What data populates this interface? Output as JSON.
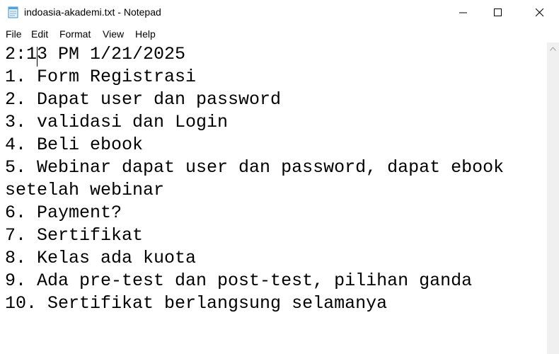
{
  "window": {
    "title": "indoasia-akademi.txt - Notepad",
    "icon": "notepad-icon"
  },
  "menu": {
    "items": [
      "File",
      "Edit",
      "Format",
      "View",
      "Help"
    ]
  },
  "editor": {
    "lines": [
      "2:13 PM 1/21/2025",
      "1. Form Registrasi",
      "2. Dapat user dan password",
      "3. validasi dan Login",
      "4. Beli ebook",
      "5. Webinar dapat user dan password, dapat ebook",
      "setelah webinar",
      "6. Payment?",
      "7. Sertifikat",
      "8. Kelas ada kuota",
      "9. Ada pre-test dan post-test, pilihan ganda",
      "10. Sertifikat berlangsung selamanya"
    ]
  }
}
